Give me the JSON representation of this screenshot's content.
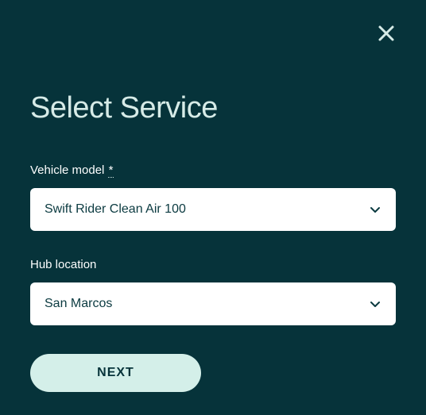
{
  "dialog": {
    "title": "Select Service"
  },
  "fields": {
    "vehicle_model": {
      "label": "Vehicle model",
      "required_mark": "*",
      "value": "Swift Rider Clean Air 100"
    },
    "hub_location": {
      "label": "Hub location",
      "value": "San Marcos"
    }
  },
  "actions": {
    "next": "NEXT"
  }
}
